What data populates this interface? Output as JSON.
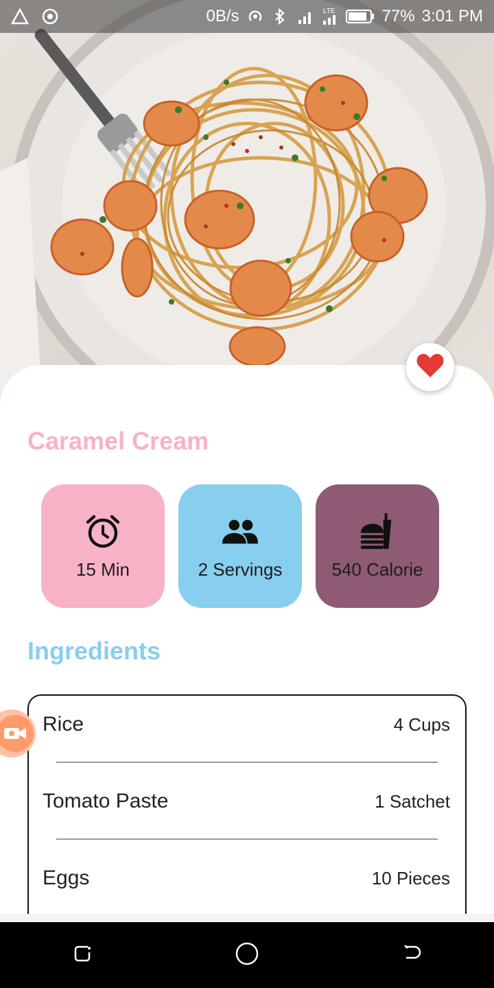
{
  "status_bar": {
    "net_speed": "0B/s",
    "network_type": "LTE",
    "battery": "77%",
    "time": "3:01 PM",
    "icons": [
      "warning-triangle-icon",
      "target-icon",
      "hotspot-icon",
      "bluetooth-icon",
      "signal-icon",
      "lte-signal-icon",
      "battery-icon"
    ]
  },
  "hero": {
    "image_subject": "shrimp spaghetti on a plate with a fork"
  },
  "recipe": {
    "title": "Caramel Cream",
    "favorite_icon": "heart-icon",
    "favorite_color": "#e53935",
    "stats": [
      {
        "icon": "alarm-clock-icon",
        "label": "15 Min",
        "color": "#f7b2c5"
      },
      {
        "icon": "people-icon",
        "label": "2 Servings",
        "color": "#87ceef"
      },
      {
        "icon": "fastfood-icon",
        "label": "540 Calorie",
        "color": "#8f5a73"
      }
    ]
  },
  "ingredients": {
    "title": "Ingredients",
    "items": [
      {
        "name": "Rice",
        "qty": "4 Cups"
      },
      {
        "name": "Tomato Paste",
        "qty": "1 Satchet"
      },
      {
        "name": "Eggs",
        "qty": "10 Pieces"
      }
    ]
  },
  "floating": {
    "record_icon": "video-camera-icon"
  },
  "nav_bar": {
    "buttons": [
      "recent-apps-icon",
      "home-icon",
      "back-icon"
    ]
  },
  "colors": {
    "accent_pink": "#f7b2c5",
    "accent_blue": "#87ceef",
    "accent_plum": "#8f5a73"
  }
}
